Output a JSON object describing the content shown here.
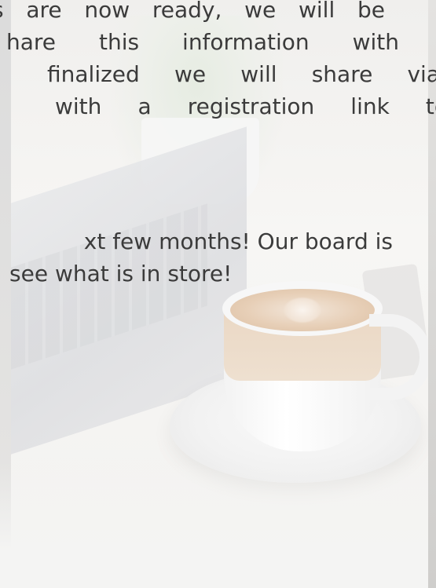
{
  "paragraph_1": {
    "lines": [
      "s are now ready, we will be",
      "hare this information with",
      "finalized we will share via",
      "with a registration link to"
    ]
  },
  "paragraph_2": {
    "lines": [
      "xt few months! Our board is",
      "see what is in store!"
    ]
  }
}
